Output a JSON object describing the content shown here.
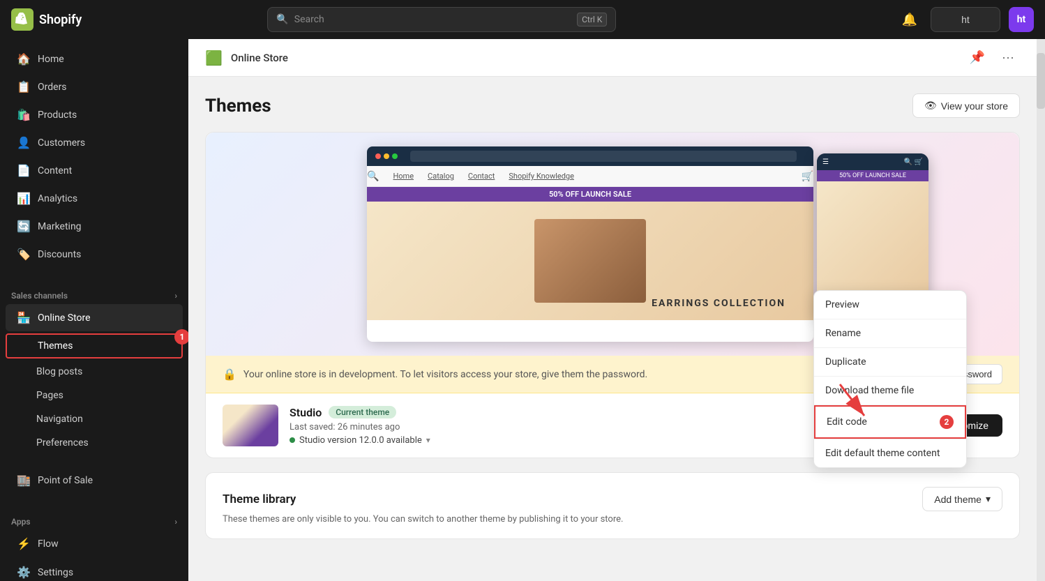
{
  "app": {
    "name": "Shopify",
    "logo_text": "S"
  },
  "topnav": {
    "search_placeholder": "Search",
    "search_shortcut": "Ctrl K",
    "bell_icon": "bell",
    "store_label": "ht",
    "avatar_initials": "ht"
  },
  "sidebar": {
    "nav_items": [
      {
        "id": "home",
        "label": "Home",
        "icon": "🏠"
      },
      {
        "id": "orders",
        "label": "Orders",
        "icon": "📋"
      },
      {
        "id": "products",
        "label": "Products",
        "icon": "🛍️"
      },
      {
        "id": "customers",
        "label": "Customers",
        "icon": "👤"
      },
      {
        "id": "content",
        "label": "Content",
        "icon": "📄"
      },
      {
        "id": "analytics",
        "label": "Analytics",
        "icon": "📊"
      },
      {
        "id": "marketing",
        "label": "Marketing",
        "icon": "🔄"
      },
      {
        "id": "discounts",
        "label": "Discounts",
        "icon": "🏷️"
      }
    ],
    "sales_channels_label": "Sales channels",
    "sales_channels_items": [
      {
        "id": "online-store",
        "label": "Online Store",
        "icon": "🏪"
      }
    ],
    "sub_items": [
      {
        "id": "themes",
        "label": "Themes",
        "active": true
      },
      {
        "id": "blog-posts",
        "label": "Blog posts"
      },
      {
        "id": "pages",
        "label": "Pages"
      },
      {
        "id": "navigation",
        "label": "Navigation"
      },
      {
        "id": "preferences",
        "label": "Preferences"
      }
    ],
    "other_items": [
      {
        "id": "point-of-sale",
        "label": "Point of Sale",
        "icon": "🏬"
      }
    ],
    "apps_label": "Apps",
    "apps_items": [
      {
        "id": "flow",
        "label": "Flow",
        "icon": "⚡"
      }
    ],
    "settings_label": "Settings",
    "settings_icon": "⚙️"
  },
  "page_header": {
    "icon": "🟩",
    "title": "Online Store",
    "pin_icon": "pin",
    "more_icon": "more"
  },
  "main": {
    "section_title": "Themes",
    "view_store_btn": "View your store",
    "theme_preview": {
      "nav_links": [
        "Home",
        "Catalog",
        "Contact",
        "Shopify Knowledge"
      ],
      "promo_text": "50% OFF LAUNCH SALE",
      "hero_text": "EARRINGS COLLECTION"
    },
    "warning_banner": {
      "icon": "🔒",
      "text": "Your online store is in development. To let visitors access your store, give them the password.",
      "action_label": "store password"
    },
    "current_theme": {
      "name": "Studio",
      "badge": "Current theme",
      "saved_text": "Last saved: 26 minutes ago",
      "version_text": "Studio version 12.0.0 available",
      "customize_btn": "Customize"
    },
    "dropdown_menu": {
      "items": [
        {
          "id": "preview",
          "label": "Preview"
        },
        {
          "id": "rename",
          "label": "Rename"
        },
        {
          "id": "duplicate",
          "label": "Duplicate"
        },
        {
          "id": "download",
          "label": "Download theme file"
        },
        {
          "id": "edit-code",
          "label": "Edit code",
          "badge": "2",
          "highlighted": true
        },
        {
          "id": "edit-default",
          "label": "Edit default theme content"
        }
      ]
    },
    "theme_library": {
      "title": "Theme library",
      "description": "These themes are only visible to you. You can switch to another theme by publishing it to your store.",
      "add_theme_btn": "Add theme"
    },
    "badge_1": "1"
  }
}
